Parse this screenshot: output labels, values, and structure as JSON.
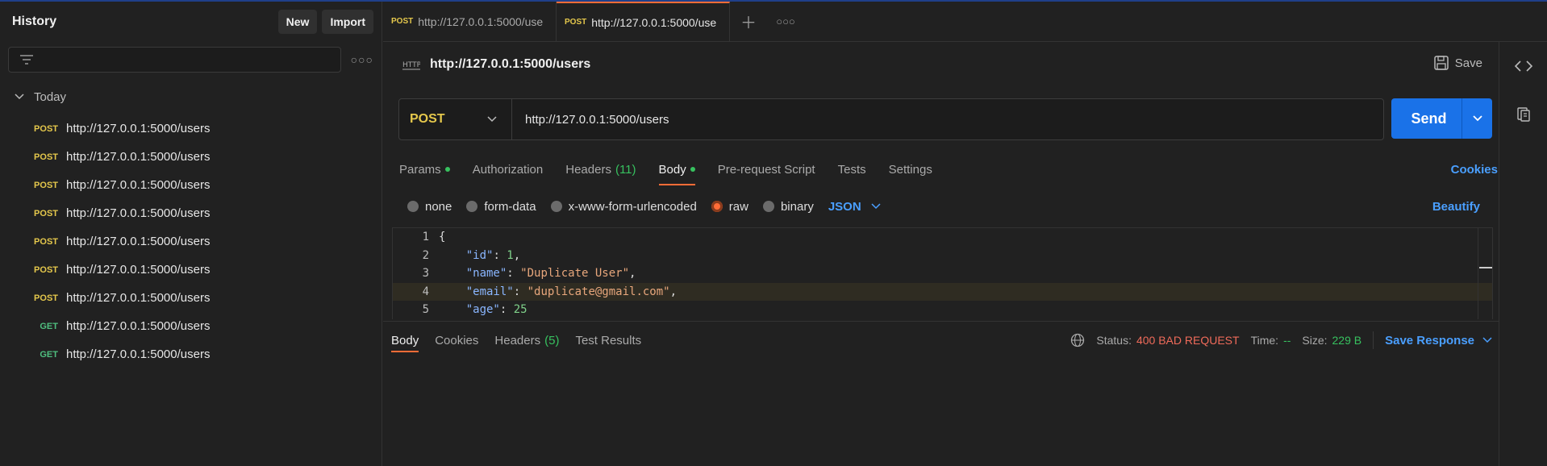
{
  "sidebar": {
    "title": "History",
    "new_label": "New",
    "import_label": "Import",
    "group_label": "Today",
    "items": [
      {
        "method": "POST",
        "url": "http://127.0.0.1:5000/users"
      },
      {
        "method": "POST",
        "url": "http://127.0.0.1:5000/users"
      },
      {
        "method": "POST",
        "url": "http://127.0.0.1:5000/users"
      },
      {
        "method": "POST",
        "url": "http://127.0.0.1:5000/users"
      },
      {
        "method": "POST",
        "url": "http://127.0.0.1:5000/users"
      },
      {
        "method": "POST",
        "url": "http://127.0.0.1:5000/users"
      },
      {
        "method": "POST",
        "url": "http://127.0.0.1:5000/users"
      },
      {
        "method": "GET",
        "url": "http://127.0.0.1:5000/users"
      },
      {
        "method": "GET",
        "url": "http://127.0.0.1:5000/users"
      }
    ]
  },
  "tabs": [
    {
      "method": "POST",
      "label": "http://127.0.0.1:5000/use"
    },
    {
      "method": "POST",
      "label": "http://127.0.0.1:5000/use"
    }
  ],
  "request": {
    "title": "http://127.0.0.1:5000/users",
    "save_label": "Save",
    "method": "POST",
    "url": "http://127.0.0.1:5000/users",
    "send_label": "Send",
    "tabs": {
      "params": "Params",
      "authorization": "Authorization",
      "headers": "Headers",
      "headers_count": "(11)",
      "body": "Body",
      "prerequest": "Pre-request Script",
      "tests": "Tests",
      "settings": "Settings"
    },
    "cookies_label": "Cookies",
    "body_types": {
      "none": "none",
      "form_data": "form-data",
      "urlencoded": "x-www-form-urlencoded",
      "raw": "raw",
      "binary": "binary",
      "format": "JSON"
    },
    "beautify_label": "Beautify",
    "code_lines": [
      {
        "num": "1",
        "text": "{"
      },
      {
        "num": "2",
        "key": "\"id\"",
        "value": "1",
        "value_type": "number",
        "trail": ","
      },
      {
        "num": "3",
        "key": "\"name\"",
        "value": "\"Duplicate User\"",
        "value_type": "string",
        "trail": ","
      },
      {
        "num": "4",
        "key": "\"email\"",
        "value": "\"duplicate@gmail.com\"",
        "value_type": "string",
        "trail": ","
      },
      {
        "num": "5",
        "key": "\"age\"",
        "value": "25",
        "value_type": "number",
        "trail": ""
      }
    ]
  },
  "response": {
    "tabs": {
      "body": "Body",
      "cookies": "Cookies",
      "headers": "Headers",
      "headers_count": "(5)",
      "test_results": "Test Results"
    },
    "status_label": "Status:",
    "status_value": "400 BAD REQUEST",
    "time_label": "Time:",
    "time_value": "--",
    "size_label": "Size:",
    "size_value": "229 B",
    "save_response_label": "Save Response"
  },
  "colors": {
    "accent_orange": "#ff6c37",
    "send_blue": "#1a72e8",
    "post_yellow": "#e5c84c",
    "get_green": "#4fbf7f",
    "status_red": "#f06b5a"
  }
}
